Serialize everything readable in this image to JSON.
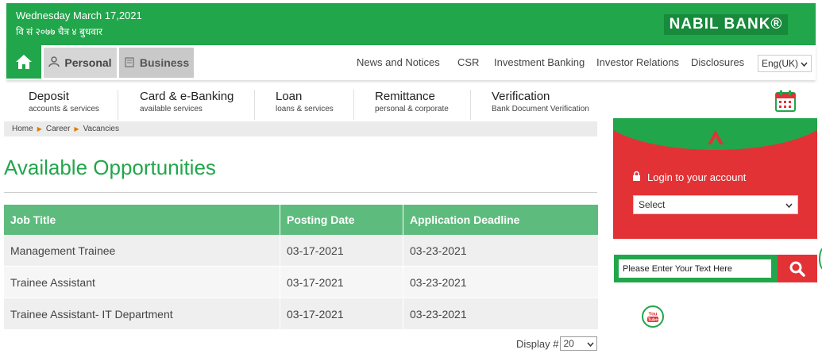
{
  "header": {
    "date_en": "Wednesday March 17,2021",
    "date_np": "वि सं २०७७ चैत्र ४ बुधवार",
    "logo": "NABIL BANK®"
  },
  "nav": {
    "home_icon": "home-icon",
    "personal": "Personal",
    "business": "Business",
    "links": [
      "News and Notices",
      "CSR",
      "Investment Banking",
      "Investor Relations",
      "Disclosures"
    ],
    "language": "Eng(UK)"
  },
  "menu": [
    {
      "title": "Deposit",
      "sub": "accounts & services"
    },
    {
      "title": "Card & e-Banking",
      "sub": "available services"
    },
    {
      "title": "Loan",
      "sub": "loans & services"
    },
    {
      "title": "Remittance",
      "sub": "personal & corporate"
    },
    {
      "title": "Verification",
      "sub": "Bank Document Verification"
    }
  ],
  "breadcrumb": [
    "Home",
    "Career",
    "Vacancies"
  ],
  "page_title": "Available Opportunities",
  "table": {
    "headers": [
      "Job Title",
      "Posting Date",
      "Application Deadline"
    ],
    "rows": [
      [
        "Management Trainee",
        "03-17-2021",
        "03-23-2021"
      ],
      [
        "Trainee Assistant",
        "03-17-2021",
        "03-23-2021"
      ],
      [
        "Trainee Assistant- IT Department",
        "03-17-2021",
        "03-23-2021"
      ]
    ]
  },
  "display": {
    "label": "Display #",
    "value": "20"
  },
  "login": {
    "label": "Login to your account",
    "select": "Select"
  },
  "search": {
    "placeholder": "Please Enter Your Text Here"
  },
  "social": {
    "youtube": "You Tube"
  },
  "colors": {
    "green": "#21a64b",
    "red": "#e23236",
    "table_header": "#5dbb7d"
  }
}
